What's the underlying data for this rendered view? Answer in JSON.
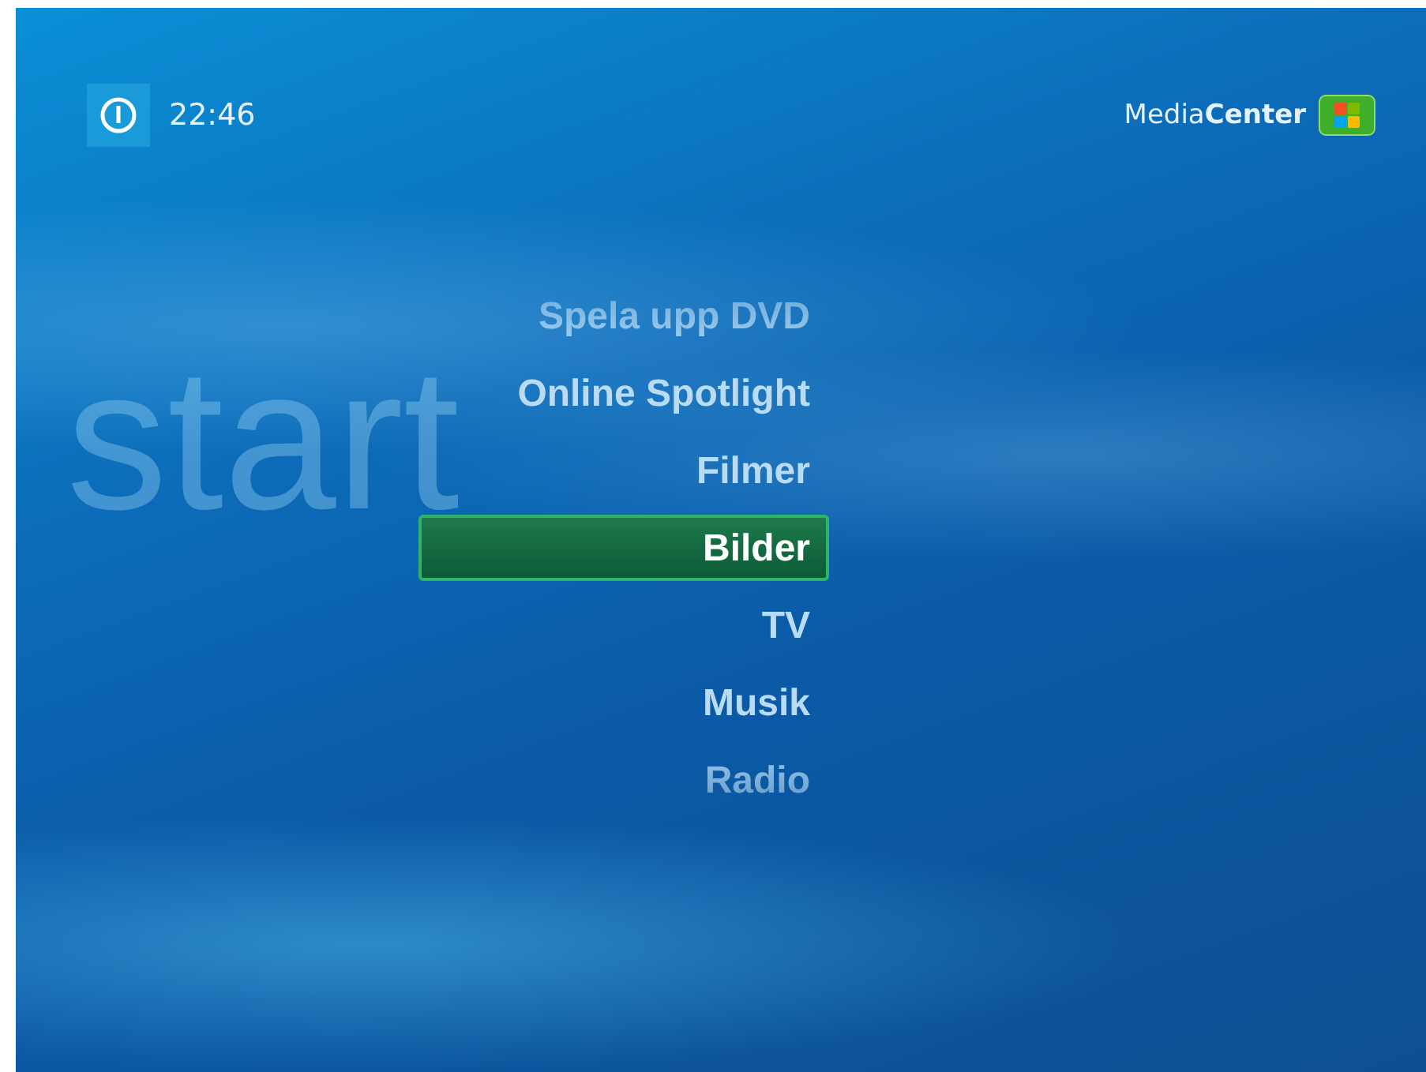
{
  "header": {
    "time": "22:46",
    "brand_light": "Media",
    "brand_bold": "Center"
  },
  "section_title": "start",
  "menu": [
    {
      "label": "Spela upp DVD",
      "selected": false
    },
    {
      "label": "Online Spotlight",
      "selected": false
    },
    {
      "label": "Filmer",
      "selected": false
    },
    {
      "label": "Bilder",
      "selected": true
    },
    {
      "label": "TV",
      "selected": false
    },
    {
      "label": "Musik",
      "selected": false
    },
    {
      "label": "Radio",
      "selected": false
    }
  ]
}
